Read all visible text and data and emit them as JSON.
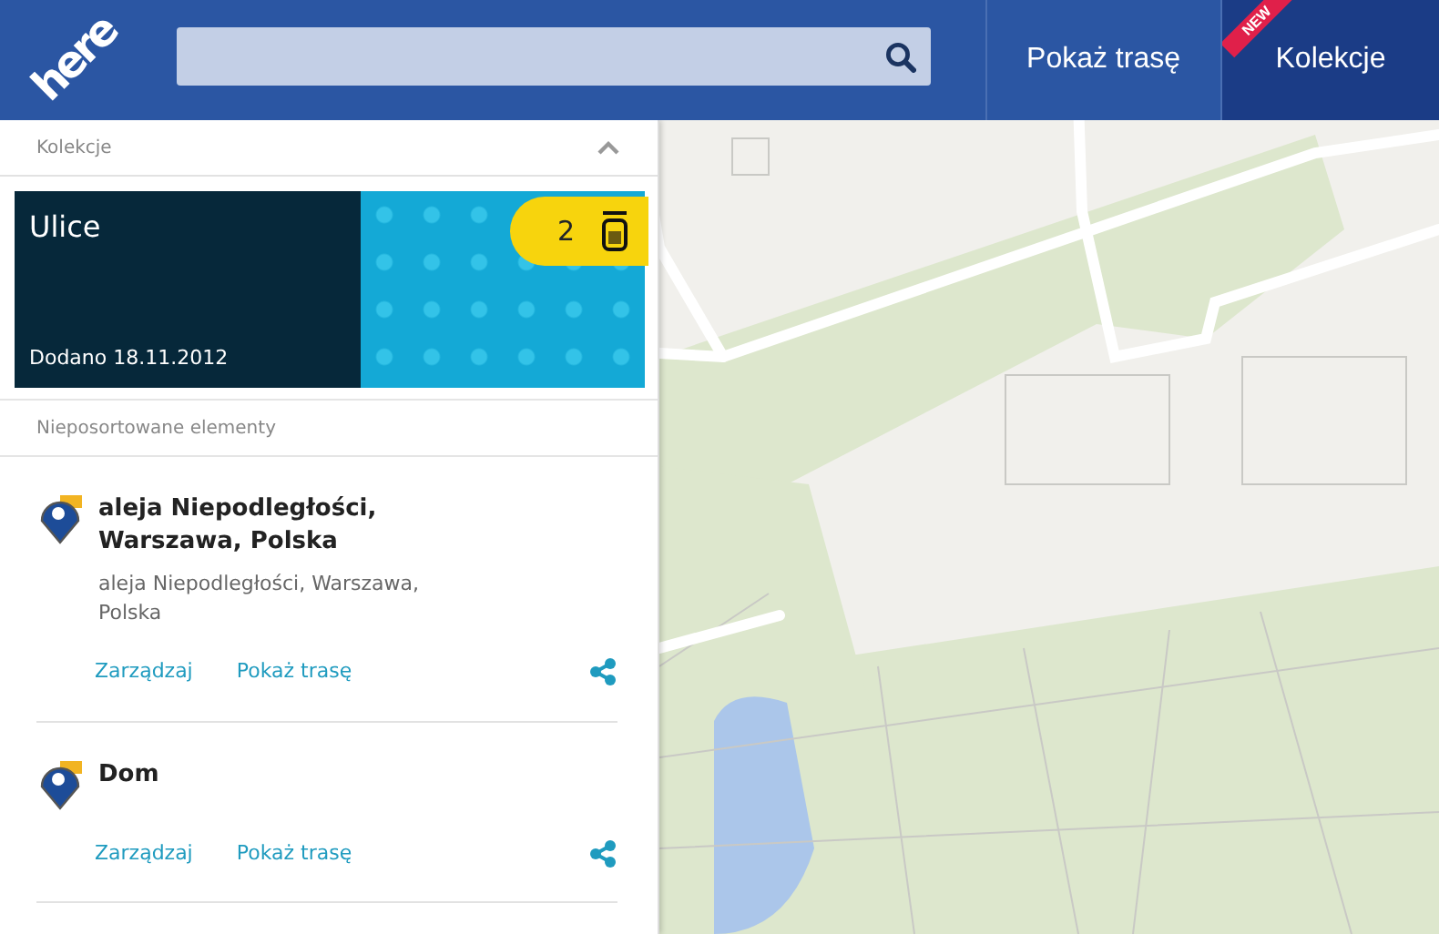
{
  "header": {
    "logo": "here",
    "nav": [
      {
        "label": "Pokaż trasę",
        "selected": false
      },
      {
        "label": "Kolekcje",
        "selected": true,
        "badge": "NEW"
      }
    ]
  },
  "sidebar": {
    "section_title": "Kolekcje",
    "expanded": true,
    "collection": {
      "title": "Ulice",
      "date": "Dodano 18.11.2012",
      "count": "2"
    },
    "list_title": "Nieposortowane elementy",
    "places": [
      {
        "name": "aleja Niepodległości, Warszawa, Polska",
        "address": "aleja Niepodległości, Warszawa, Polska",
        "actions": [
          "Zarządzaj",
          "Pokaż trasę"
        ]
      },
      {
        "name": "Dom",
        "actions": [
          "Zarządzaj",
          "Pokaż trasę"
        ]
      }
    ]
  }
}
